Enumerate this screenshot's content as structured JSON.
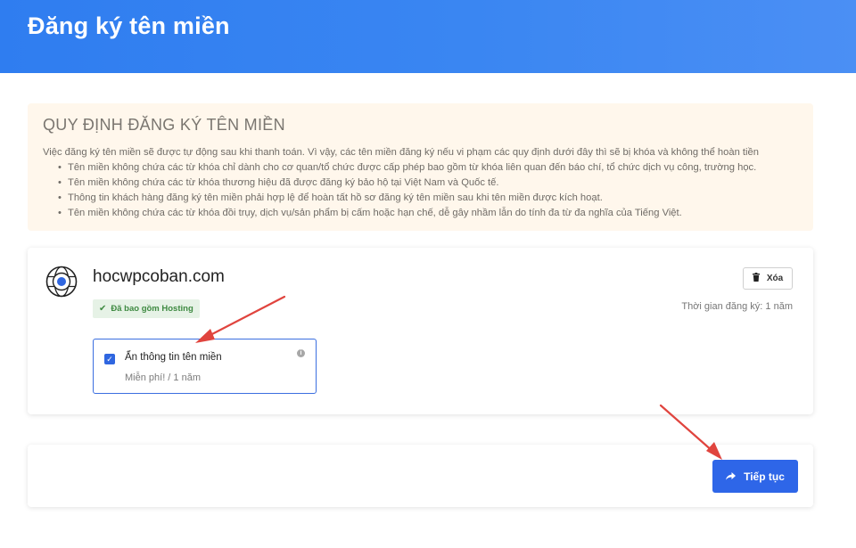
{
  "header": {
    "title": "Đăng ký tên miền"
  },
  "rules": {
    "title": "QUY ĐỊNH ĐĂNG KÝ TÊN MIỀN",
    "intro": "Việc đăng ký tên miền sẽ được tự động sau khi thanh toán. Vì vậy, các tên miền đăng ký nếu vi phạm các quy định dưới đây thì sẽ bị khóa và không thể hoàn tiền",
    "items": [
      "Tên miền không chứa các từ khóa chỉ dành cho cơ quan/tổ chức được cấp phép bao gồm từ khóa liên quan đến báo chí, tổ chức dịch vụ công, trường học.",
      "Tên miền không chứa các từ khóa thương hiệu đã được đăng ký bảo hộ tại Việt Nam và Quốc tế.",
      "Thông tin khách hàng đăng ký tên miền phải hợp lệ để hoàn tất hồ sơ đăng ký tên miền sau khi tên miền được kích hoạt.",
      "Tên miền không chứa các từ khóa đồi trụy, dịch vụ/sản phẩm bị cấm hoặc hạn chế, dễ gây nhầm lẫn do tính đa từ đa nghĩa của Tiếng Việt."
    ]
  },
  "domain": {
    "name": "hocwpcoban.com",
    "badge": "Đã bao gồm Hosting",
    "delete_label": "Xóa",
    "registration_time": "Thời gian đăng ký: 1 năm",
    "privacy_option": {
      "label": "Ẩn thông tin tên miền",
      "price": "Miễn phí! / 1 năm",
      "checked": true
    }
  },
  "actions": {
    "continue_label": "Tiếp tục"
  },
  "colors": {
    "header_bg": "#3a86f2",
    "rules_bg": "#fff7ec",
    "badge_bg": "#e6f2e6",
    "badge_text": "#3f8a42",
    "primary_button": "#2e66e8",
    "annotation_arrow": "#e0443e"
  },
  "icons": {
    "globe": "globe-icon",
    "check": "check-icon",
    "info": "info-icon",
    "trash": "trash-icon",
    "arrow": "share-arrow-icon"
  }
}
